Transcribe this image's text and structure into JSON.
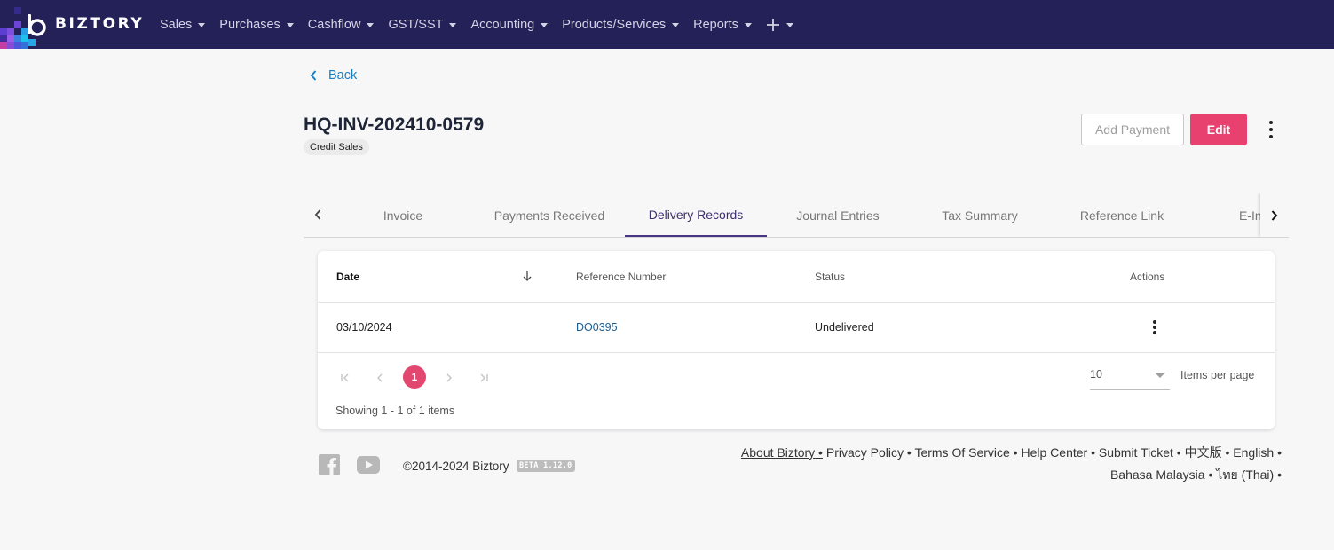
{
  "brand": {
    "name": "BIZTORY"
  },
  "nav": {
    "items": [
      {
        "label": "Sales"
      },
      {
        "label": "Purchases"
      },
      {
        "label": "Cashflow"
      },
      {
        "label": "GST/SST"
      },
      {
        "label": "Accounting"
      },
      {
        "label": "Products/Services"
      },
      {
        "label": "Reports"
      }
    ],
    "plus_icon": "plus-icon"
  },
  "back": {
    "label": "Back"
  },
  "document": {
    "title": "HQ-INV-202410-0579",
    "type_badge": "Credit Sales"
  },
  "actions": {
    "add_payment_label": "Add Payment",
    "edit_label": "Edit"
  },
  "tabs": [
    {
      "label": "Invoice"
    },
    {
      "label": "Payments Received"
    },
    {
      "label": "Delivery Records"
    },
    {
      "label": "Journal Entries"
    },
    {
      "label": "Tax Summary"
    },
    {
      "label": "Reference Link"
    },
    {
      "label": "E-In"
    }
  ],
  "active_tab": "Delivery Records",
  "table": {
    "columns": [
      "Date",
      "Reference Number",
      "Status",
      "Actions"
    ],
    "rows": [
      {
        "date": "03/10/2024",
        "reference": "DO0395",
        "status": "Undelivered"
      }
    ]
  },
  "pagination": {
    "current_page": "1",
    "page_size": "10",
    "per_page_label": "Items per page",
    "showing": "Showing 1 - 1 of 1 items"
  },
  "footer": {
    "copyright": "©2014-2024 Biztory",
    "version": "BETA 1.12.0",
    "links": [
      "About Biztory",
      "Privacy Policy",
      "Terms Of Service",
      "Help Center",
      "Submit Ticket",
      "中文版",
      "English",
      "Bahasa Malaysia",
      "ไทย (Thai)"
    ]
  },
  "colors": {
    "navbar": "#242058",
    "accent": "#e8416f",
    "active_tab": "#4a3585",
    "link": "#1a7fc1"
  }
}
